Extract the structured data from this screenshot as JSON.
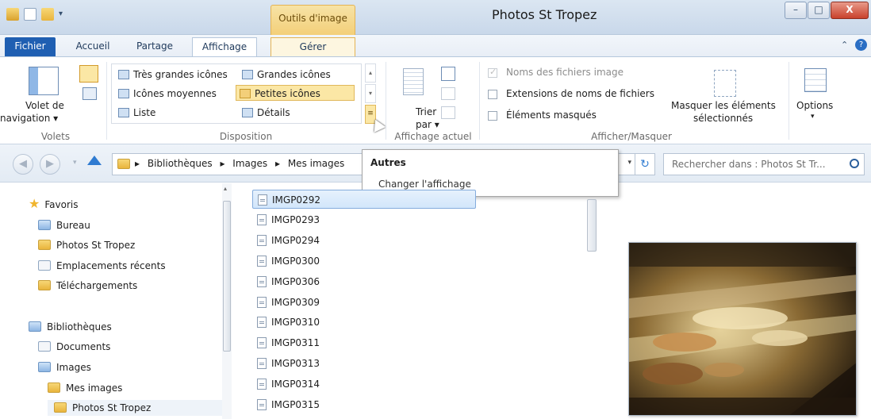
{
  "window": {
    "title": "Photos St Tropez",
    "minimize_glyph": "–",
    "maximize_glyph": "□",
    "close_glyph": "X"
  },
  "title_bar": {
    "context_tab_group": "Outils d'image"
  },
  "tabs": {
    "fichier": "Fichier",
    "accueil": "Accueil",
    "partage": "Partage",
    "affichage": "Affichage",
    "gerer": "Gérer"
  },
  "ribbon": {
    "volets": {
      "nav_pane_line1": "Volet de",
      "nav_pane_line2": "navigation ▾",
      "group_label": "Volets"
    },
    "disposition": {
      "items": {
        "tres_grandes": "Très grandes icônes",
        "grandes": "Grandes icônes",
        "moyennes": "Icônes moyennes",
        "petites": "Petites icônes",
        "liste": "Liste",
        "details": "Détails"
      },
      "selected": "Petites icônes",
      "group_label": "Disposition"
    },
    "affichage_actuel": {
      "trier_line1": "Trier",
      "trier_line2": "par ▾",
      "group_label": "Affichage actuel"
    },
    "afficher_masquer": {
      "noms_fichiers": "Noms des fichiers image",
      "extensions": "Extensions de noms de fichiers",
      "elements_masques": "Éléments masqués",
      "masquer_line1": "Masquer les éléments",
      "masquer_line2": "sélectionnés",
      "group_label": "Afficher/Masquer"
    },
    "options": {
      "label": "Options",
      "arrow": "▾"
    }
  },
  "address": {
    "crumbs": [
      "Bibliothèques",
      "Images",
      "Mes images"
    ],
    "sep": "▸",
    "search_placeholder": "Rechercher dans : Photos St Tr...",
    "refresh_glyph": "↻"
  },
  "tooltip": {
    "title": "Autres",
    "body": "Changer l'affichage"
  },
  "nav": {
    "favoris": "Favoris",
    "bureau": "Bureau",
    "photos": "Photos St Tropez",
    "emplacements": "Emplacements récents",
    "telechargements": "Téléchargements",
    "bibliotheques": "Bibliothèques",
    "documents": "Documents",
    "images": "Images",
    "mes_images": "Mes images",
    "photos_st_tropez": "Photos St Tropez"
  },
  "files": [
    "IMGP0292",
    "IMGP0293",
    "IMGP0294",
    "IMGP0300",
    "IMGP0306",
    "IMGP0309",
    "IMGP0310",
    "IMGP0311",
    "IMGP0313",
    "IMGP0314",
    "IMGP0315"
  ],
  "colors": {
    "accent": "#1f5fb2",
    "context_tab": "#f3cf79",
    "selection": "#fbe7a5"
  }
}
